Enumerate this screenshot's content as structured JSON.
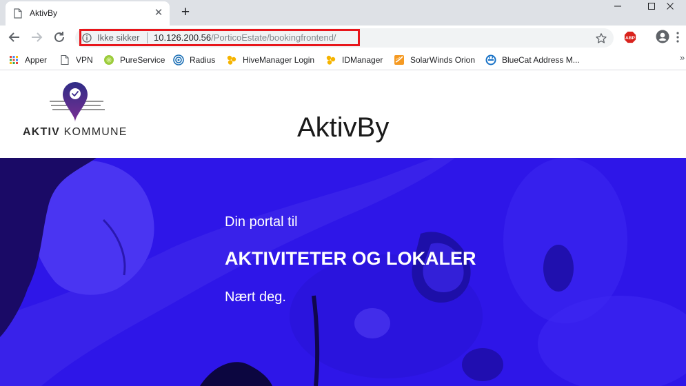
{
  "browser": {
    "tab": {
      "title": "AktivBy",
      "close_glyph": "✕"
    },
    "new_tab_glyph": "+",
    "omnibox": {
      "security_label": "Ikke sikker",
      "url_host": "10.126.200.56",
      "url_path": "/PorticoEstate/bookingfrontend/"
    },
    "extensions": {
      "abp_label": "ABP"
    },
    "bookmarks": [
      {
        "label": "Apper",
        "icon": "apps-grid-icon"
      },
      {
        "label": "VPN",
        "icon": "page-icon"
      },
      {
        "label": "PureService",
        "icon": "pureservice-icon"
      },
      {
        "label": "Radius",
        "icon": "radius-icon"
      },
      {
        "label": "HiveManager Login",
        "icon": "hivemanager-icon"
      },
      {
        "label": "IDManager",
        "icon": "idmanager-icon"
      },
      {
        "label": "SolarWinds Orion",
        "icon": "solarwinds-icon"
      },
      {
        "label": "BlueCat Address M...",
        "icon": "bluecat-icon"
      }
    ],
    "bookmarks_overflow": "»"
  },
  "site": {
    "logo": {
      "word1": "AKTIV",
      "word2": "KOMMUNE"
    },
    "title": "AktivBy"
  },
  "hero": {
    "subtitle": "Din portal til",
    "headline": "AKTIVITETER OG LOKALER",
    "tagline": "Nært deg."
  },
  "colors": {
    "hero_tint": "#2e16e8",
    "logo_purple": "#3d2c8d",
    "highlight_box": "#e8161b"
  }
}
